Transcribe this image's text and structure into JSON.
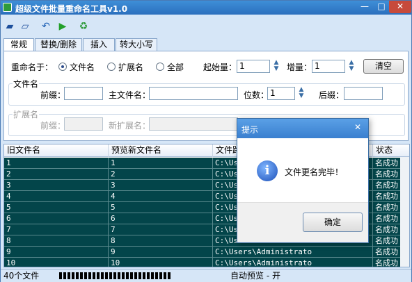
{
  "window": {
    "title": "超级文件批量重命名工具v1.0",
    "controls": {
      "minimize": "—",
      "maximize": "□",
      "close": "✕"
    }
  },
  "toolbar": {
    "icons": [
      "open-folder-icon",
      "open-file-icon",
      "undo-icon",
      "run-icon",
      "recycle-icon"
    ]
  },
  "tabs": [
    {
      "label": "常规",
      "active": true
    },
    {
      "label": "替换/删除",
      "active": false
    },
    {
      "label": "插入",
      "active": false
    },
    {
      "label": "转大小写",
      "active": false
    }
  ],
  "general": {
    "rename_label": "重命名于：",
    "radio_filename": "文件名",
    "radio_ext": "扩展名",
    "radio_all": "全部",
    "start_label": "起始量：",
    "start_value": "1",
    "step_label": "增量：",
    "step_value": "1",
    "clear_button": "清空",
    "filename_group": {
      "legend": "文件名",
      "prefix_label": "前缀：",
      "prefix_value": "",
      "main_label": "主文件名：",
      "main_value": "",
      "digits_label": "位数：",
      "digits_value": "1",
      "suffix_label": "后缀：",
      "suffix_value": ""
    },
    "ext_group": {
      "legend": "扩展名",
      "prefix_label": "前缀：",
      "prefix_value": "",
      "new_ext_label": "新扩展名：",
      "new_ext_value": ""
    }
  },
  "grid": {
    "columns": [
      "旧文件名",
      "预览新文件名",
      "文件路",
      "状态"
    ],
    "rows": [
      {
        "old": "1",
        "new": "1",
        "path": "C:\\Us",
        "status": "名成功"
      },
      {
        "old": "2",
        "new": "2",
        "path": "C:\\Us",
        "status": "名成功"
      },
      {
        "old": "3",
        "new": "3",
        "path": "C:\\Us",
        "status": "名成功"
      },
      {
        "old": "4",
        "new": "4",
        "path": "C:\\Us",
        "status": "名成功"
      },
      {
        "old": "5",
        "new": "5",
        "path": "C:\\Us",
        "status": "名成功"
      },
      {
        "old": "6",
        "new": "6",
        "path": "C:\\Us",
        "status": "名成功"
      },
      {
        "old": "7",
        "new": "7",
        "path": "C:\\Us",
        "status": "名成功"
      },
      {
        "old": "8",
        "new": "8",
        "path": "C:\\Us",
        "status": "名成功"
      },
      {
        "old": "9",
        "new": "9",
        "path": "C:\\Users\\Administrato",
        "status": "名成功"
      },
      {
        "old": "10",
        "new": "10",
        "path": "C:\\Users\\Administrato",
        "status": "名成功"
      }
    ]
  },
  "status": {
    "file_count": "40个文件",
    "auto_preview": "自动预览 - 开"
  },
  "dialog": {
    "title": "提示",
    "close": "✕",
    "message": "文件更名完毕！",
    "ok_button": "确定"
  }
}
